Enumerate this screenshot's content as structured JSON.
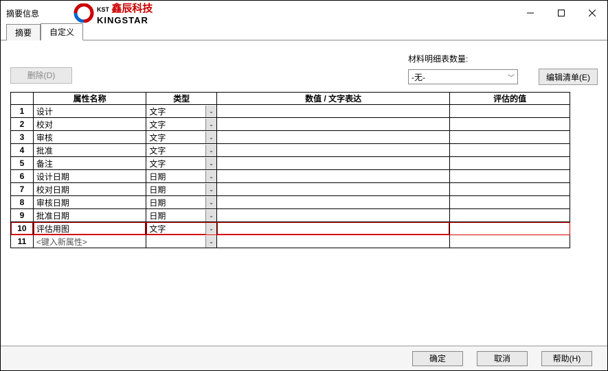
{
  "window": {
    "title": "摘要信息"
  },
  "logo": {
    "small": "KST",
    "cn": "鑫辰科技",
    "en": "KINGSTAR"
  },
  "tabs": {
    "summary": "摘要",
    "custom": "自定义"
  },
  "toolbar": {
    "delete": "删除(D)",
    "edit_list": "编辑清单(E)"
  },
  "bom": {
    "label": "材料明细表数量:",
    "value": "-无-"
  },
  "columns": {
    "name": "属性名称",
    "type": "类型",
    "value": "数值 / 文字表达",
    "eval": "评估的值"
  },
  "rows": [
    {
      "n": "1",
      "name": "设计",
      "type": "文字"
    },
    {
      "n": "2",
      "name": "校对",
      "type": "文字"
    },
    {
      "n": "3",
      "name": "审核",
      "type": "文字"
    },
    {
      "n": "4",
      "name": "批准",
      "type": "文字"
    },
    {
      "n": "5",
      "name": "备注",
      "type": "文字"
    },
    {
      "n": "6",
      "name": "设计日期",
      "type": "日期"
    },
    {
      "n": "7",
      "name": "校对日期",
      "type": "日期"
    },
    {
      "n": "8",
      "name": "审核日期",
      "type": "日期"
    },
    {
      "n": "9",
      "name": "批准日期",
      "type": "日期"
    },
    {
      "n": "10",
      "name": "评估用图",
      "type": "文字"
    },
    {
      "n": "11",
      "name": "<键入新属性>",
      "type": ""
    }
  ],
  "buttons": {
    "ok": "确定",
    "cancel": "取消",
    "help": "帮助(H)"
  }
}
